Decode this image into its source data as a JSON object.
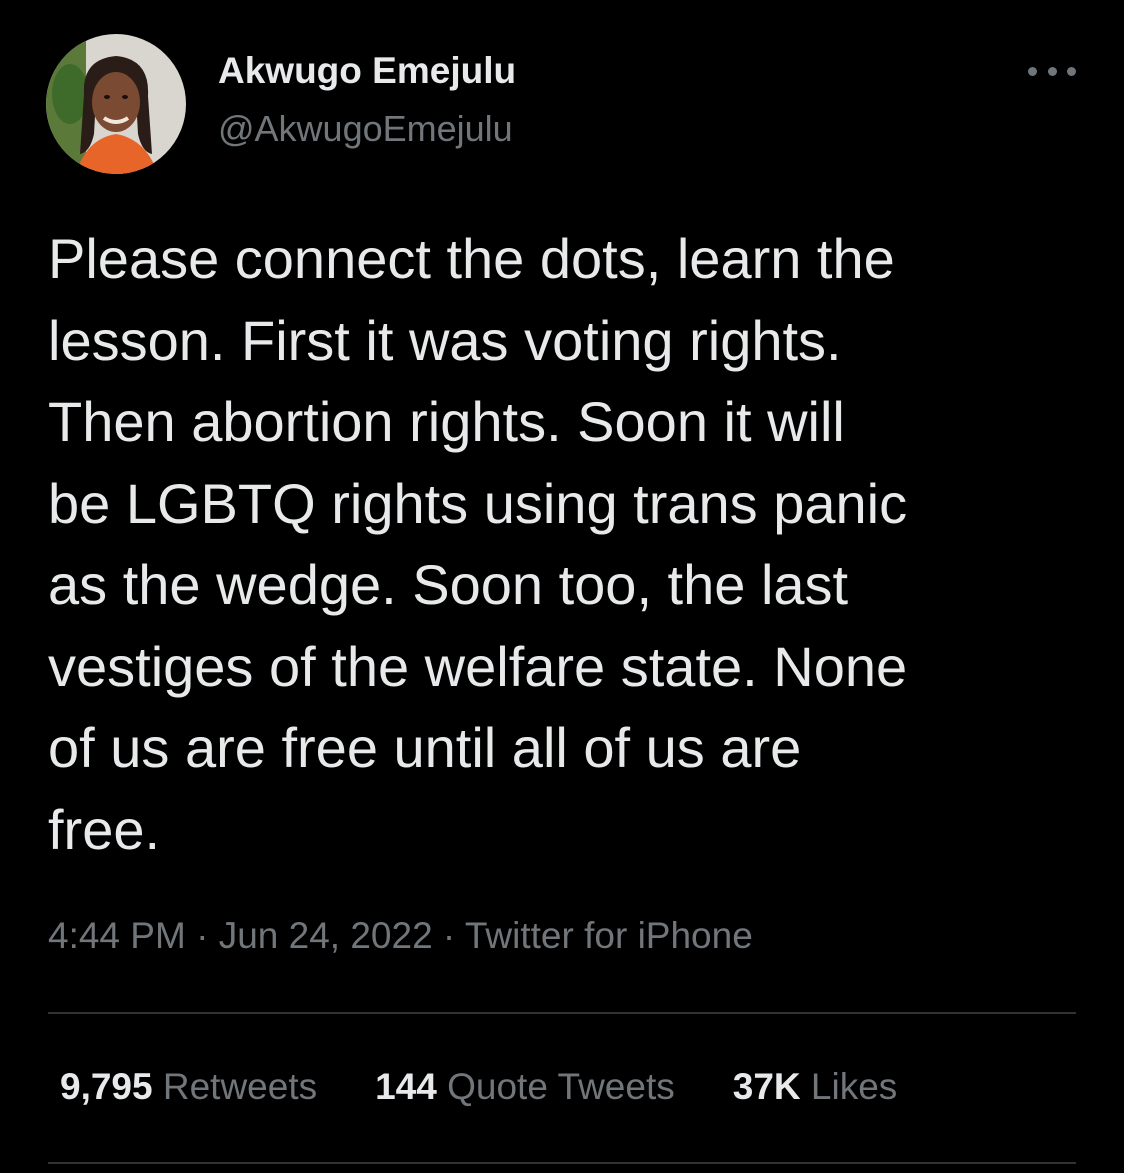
{
  "author": {
    "display_name": "Akwugo Emejulu",
    "handle": "@AkwugoEmejulu",
    "avatar_icon": "profile-photo"
  },
  "more_icon": "more-horizontal-icon",
  "tweet": {
    "text": "Please connect the dots, learn the\nlesson. First it was voting rights.\nThen abortion rights. Soon it will\nbe LGBTQ rights using trans panic\nas the wedge. Soon too, the last\nvestiges of the welfare state. None\nof us are free until all of us are\nfree."
  },
  "meta": {
    "time": "4:44 PM",
    "separator": " · ",
    "date": "Jun 24, 2022",
    "source": "Twitter for iPhone"
  },
  "stats": {
    "retweets_count": "9,795",
    "retweets_label": "Retweets",
    "quotes_count": "144",
    "quotes_label": "Quote Tweets",
    "likes_count": "37K",
    "likes_label": "Likes"
  },
  "colors": {
    "background": "#000000",
    "primary_text": "#e7e9ea",
    "secondary_text": "#71767b",
    "divider": "#2f3336"
  }
}
